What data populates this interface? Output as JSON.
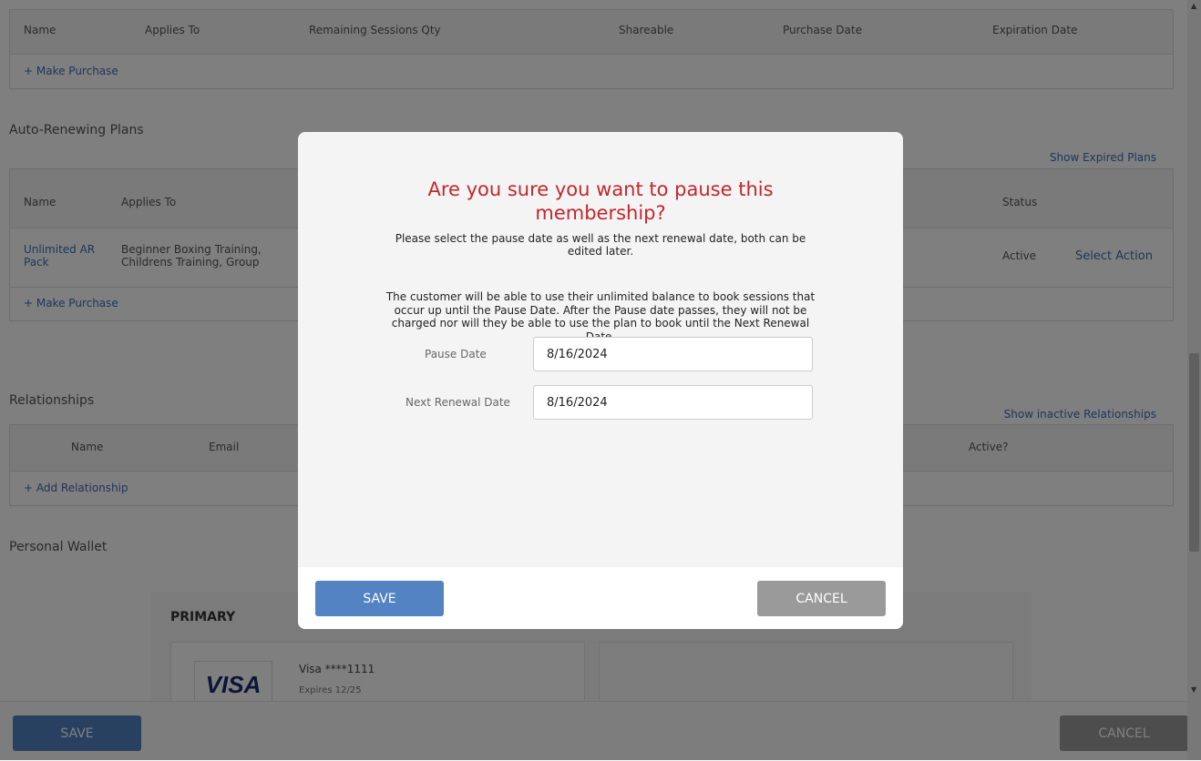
{
  "sessions_table": {
    "headers": [
      "Name",
      "Applies To",
      "Remaining Sessions Qty",
      "Shareable",
      "Purchase Date",
      "Expiration Date"
    ],
    "make_purchase": "+ Make Purchase"
  },
  "auto_renewing": {
    "title": "Auto-Renewing Plans",
    "show_expired": "Show Expired Plans",
    "headers": [
      "Name",
      "Applies To",
      "Status"
    ],
    "row": {
      "name": "Unlimited AR Pack",
      "applies_to": "Beginner Boxing Training, Childrens Training, Group Training, Free Cardi",
      "status": "Active",
      "action": "Select Action"
    },
    "make_purchase": "+ Make Purchase"
  },
  "relationships": {
    "title": "Relationships",
    "show_inactive": "Show inactive Relationships",
    "headers": [
      "Name",
      "Email",
      "Active?"
    ],
    "add": "+ Add Relationship"
  },
  "wallet": {
    "title": "Personal Wallet",
    "primary_label": "PRIMARY",
    "card_brand": "VISA",
    "card_number": "Visa ****1111",
    "card_expiry": "Expires 12/25"
  },
  "page_buttons": {
    "save": "SAVE",
    "cancel": "CANCEL"
  },
  "modal": {
    "title": "Are you sure you want to pause this membership?",
    "subtitle": "Please select the pause date as well as the next renewal date, both can be edited later.",
    "description": "The customer will be able to use their unlimited balance to book sessions that occur up until the Pause Date. After the Pause date passes, they will not be charged nor will they be able to use the plan to book until the Next Renewal Date.",
    "pause_date_label": "Pause Date",
    "pause_date_value": "8/16/2024",
    "renewal_date_label": "Next Renewal Date",
    "renewal_date_value": "8/16/2024",
    "save": "SAVE",
    "cancel": "CANCEL"
  },
  "colors": {
    "primary_button": "#5383c3",
    "cancel_button": "#9a9a9a",
    "title_red": "#c0282d",
    "link_blue": "#3a6fb5"
  }
}
